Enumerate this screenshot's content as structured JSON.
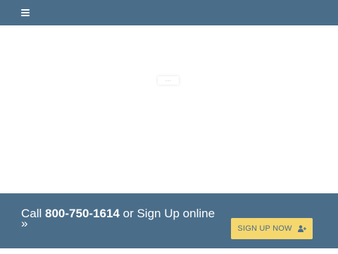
{
  "header": {
    "menu_icon": "hamburger-menu-icon"
  },
  "loader": {
    "text": "......"
  },
  "cta": {
    "call_prefix": "Call ",
    "phone": "800-750-1614",
    "middle": " or Sign Up online",
    "arrow": "»",
    "button_label": "SIGN UP NOW",
    "button_icon": "user-plus-icon"
  },
  "colors": {
    "header_bg": "#4a6e8a",
    "cta_bg": "#4a6e8a",
    "button_bg": "#f5d76e",
    "button_text": "#4a6e8a"
  }
}
